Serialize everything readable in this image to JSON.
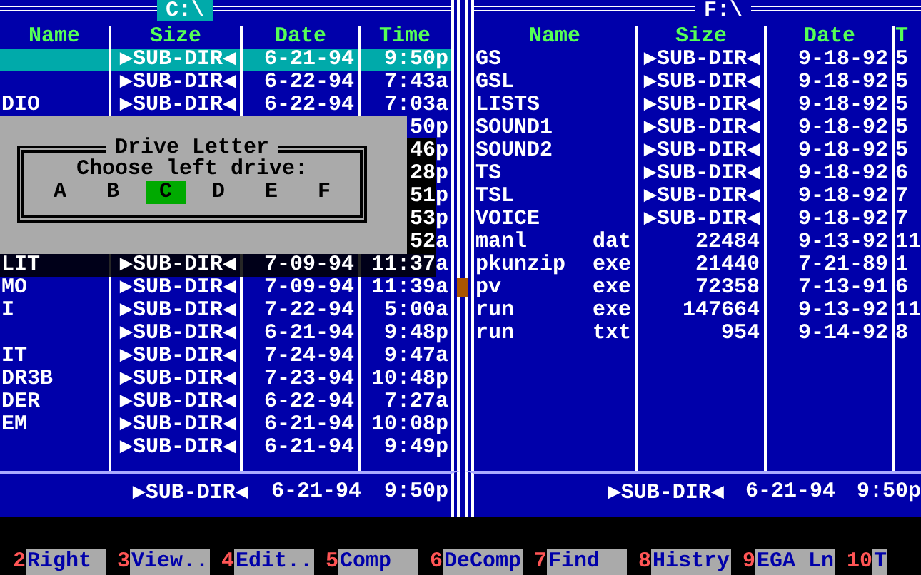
{
  "left_panel": {
    "title": "C:\\",
    "active": true,
    "columns": [
      "Name",
      "Size",
      "Date",
      "Time"
    ],
    "rows": [
      {
        "name": "",
        "size": "▶SUB-DIR◀",
        "date": "6-21-94",
        "time": "9:50p",
        "selected": true
      },
      {
        "size": "▶SUB-DIR◀",
        "date": "6-22-94",
        "time": "7:43a",
        "selected": false
      },
      {
        "name": "DIO",
        "size": "▶SUB-DIR◀",
        "date": "6-22-94",
        "time": "7:03a",
        "selected": false
      },
      {
        "time": "50p",
        "selected": false
      },
      {
        "time": "46p",
        "selected": false
      },
      {
        "time": "28p",
        "selected": false
      },
      {
        "time": "51p",
        "selected": false
      },
      {
        "time": "53p",
        "selected": false
      },
      {
        "time": "52a",
        "selected": false
      },
      {
        "name": "LIT",
        "size": "▶SUB-DIR◀",
        "date": "7-09-94",
        "time": "11:37a",
        "selected": false
      },
      {
        "name": "MO",
        "size": "▶SUB-DIR◀",
        "date": "7-09-94",
        "time": "11:39a",
        "selected": false
      },
      {
        "name": "I",
        "size": "▶SUB-DIR◀",
        "date": "7-22-94",
        "time": "5:00a",
        "selected": false
      },
      {
        "size": "▶SUB-DIR◀",
        "date": "6-21-94",
        "time": "9:48p",
        "selected": false
      },
      {
        "name": "IT",
        "size": "▶SUB-DIR◀",
        "date": "7-24-94",
        "time": "9:47a",
        "selected": false
      },
      {
        "name": "DR3B",
        "size": "▶SUB-DIR◀",
        "date": "7-23-94",
        "time": "10:48p",
        "selected": false
      },
      {
        "name": "DER",
        "size": "▶SUB-DIR◀",
        "date": "6-22-94",
        "time": "7:27a",
        "selected": false
      },
      {
        "name": "EM",
        "size": "▶SUB-DIR◀",
        "date": "6-21-94",
        "time": "10:08p",
        "selected": false
      },
      {
        "size": "▶SUB-DIR◀",
        "date": "6-21-94",
        "time": "9:49p",
        "selected": false
      }
    ],
    "footer": {
      "size": "▶SUB-DIR◀",
      "date": "6-21-94",
      "time": "9:50p"
    }
  },
  "right_panel": {
    "title": "F:\\",
    "active": false,
    "columns": [
      "Name",
      "Size",
      "Date",
      "T"
    ],
    "rows": [
      {
        "name": "GS",
        "size": "▶SUB-DIR◀",
        "date": "9-18-92",
        "time": "5",
        "selected": false
      },
      {
        "name": "GSL",
        "size": "▶SUB-DIR◀",
        "date": "9-18-92",
        "time": "5",
        "selected": false
      },
      {
        "name": "LISTS",
        "size": "▶SUB-DIR◀",
        "date": "9-18-92",
        "time": "5",
        "selected": false
      },
      {
        "name": "SOUND1",
        "size": "▶SUB-DIR◀",
        "date": "9-18-92",
        "time": "5",
        "selected": false
      },
      {
        "name": "SOUND2",
        "size": "▶SUB-DIR◀",
        "date": "9-18-92",
        "time": "5",
        "selected": false
      },
      {
        "name": "TS",
        "size": "▶SUB-DIR◀",
        "date": "9-18-92",
        "time": "6",
        "selected": false
      },
      {
        "name": "TSL",
        "size": "▶SUB-DIR◀",
        "date": "9-18-92",
        "time": "7",
        "selected": false
      },
      {
        "name": "VOICE",
        "size": "▶SUB-DIR◀",
        "date": "9-18-92",
        "time": "7",
        "selected": false
      },
      {
        "name": "manl",
        "ext": "dat",
        "size": "22484",
        "date": "9-13-92",
        "time": "11",
        "selected": false
      },
      {
        "name": "pkunzip",
        "ext": "exe",
        "size": "21440",
        "date": "7-21-89",
        "time": "1",
        "selected": false
      },
      {
        "name": "pv",
        "ext": "exe",
        "size": "72358",
        "date": "7-13-91",
        "time": "6",
        "selected": false
      },
      {
        "name": "run",
        "ext": "exe",
        "size": "147664",
        "date": "9-13-92",
        "time": "11",
        "selected": false
      },
      {
        "name": "run",
        "ext": "txt",
        "size": "954",
        "date": "9-14-92",
        "time": "8",
        "selected": false
      }
    ],
    "footer": {
      "size": "▶SUB-DIR◀",
      "date": "6-21-94",
      "time": "9:50p"
    }
  },
  "dialog": {
    "title": "Drive Letter",
    "prompt": "Choose **left** drive:",
    "drives": [
      {
        "letter": "A",
        "selected": false
      },
      {
        "letter": "B",
        "selected": false
      },
      {
        "letter": "C",
        "selected": true
      },
      {
        "letter": "D",
        "selected": false
      },
      {
        "letter": "E",
        "selected": false
      },
      {
        "letter": "F",
        "selected": false
      }
    ]
  },
  "function_keys": [
    {
      "number": "2",
      "label": "Right"
    },
    {
      "number": "3",
      "label": "View.."
    },
    {
      "number": "4",
      "label": "Edit.."
    },
    {
      "number": "5",
      "label": "Comp"
    },
    {
      "number": "6",
      "label": "DeComp"
    },
    {
      "number": "7",
      "label": "Find"
    },
    {
      "number": "8",
      "label": "Histry"
    },
    {
      "number": "9",
      "label": "EGA Ln"
    },
    {
      "number": "10",
      "label": "T"
    }
  ]
}
